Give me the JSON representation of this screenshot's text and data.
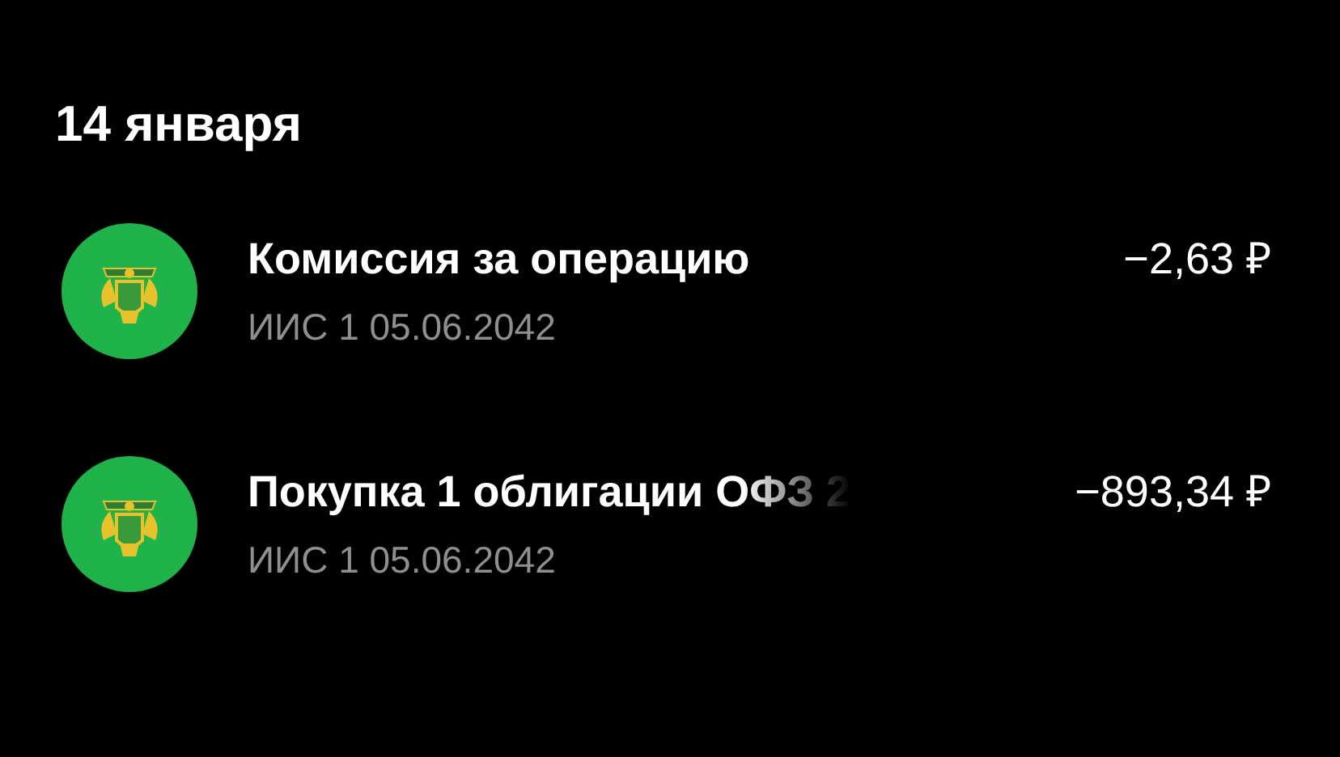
{
  "date_header": "14 января",
  "operations": [
    {
      "title": "Комиссия за операцию",
      "subtitle": "ИИС 1 05.06.2042",
      "amount": "−2,63 ₽",
      "faded": false
    },
    {
      "title": "Покупка 1 облигации ОФЗ 2",
      "subtitle": "ИИС 1 05.06.2042",
      "amount": "−893,34 ₽",
      "faded": true
    }
  ]
}
